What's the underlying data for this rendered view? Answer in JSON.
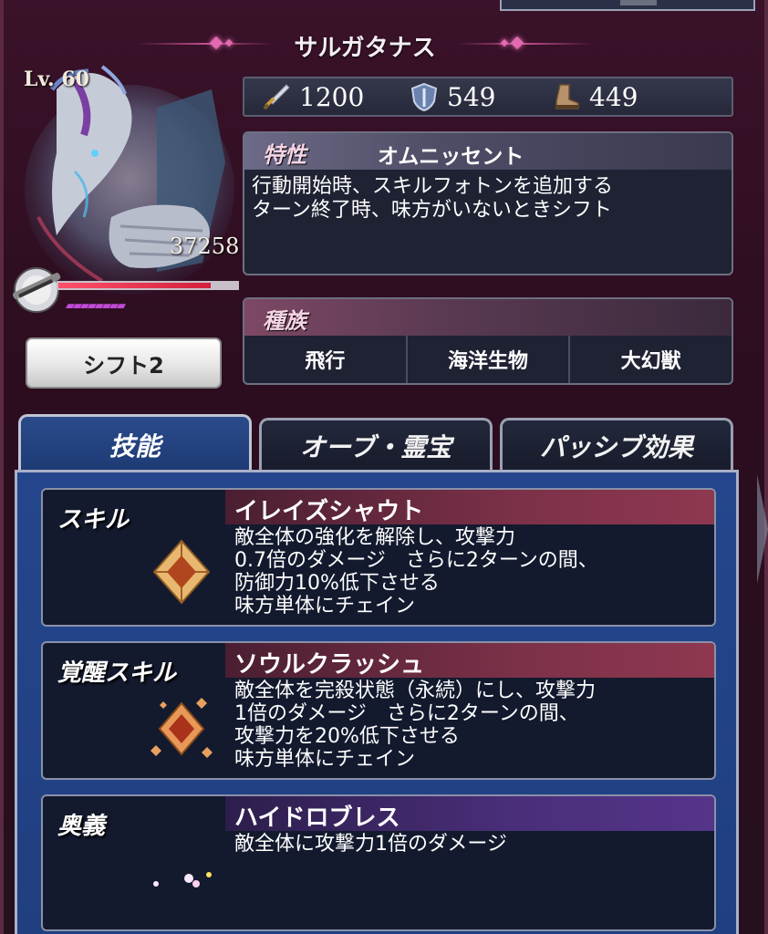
{
  "character": {
    "name": "サルガタナス",
    "level": "Lv. 60",
    "hp": "37258",
    "shift_gauge": 0.85
  },
  "shift_button": {
    "label": "シフト2"
  },
  "stats": {
    "attack": "1200",
    "defense": "549",
    "speed": "449"
  },
  "trait": {
    "label": "特性",
    "name": "オムニッセント",
    "description_lines": [
      "行動開始時、スキルフォトンを追加する",
      "ターン終了時、味方がいないときシフト"
    ]
  },
  "tribe": {
    "label": "種族",
    "items": [
      "飛行",
      "海洋生物",
      "大幻獣"
    ]
  },
  "tabs": [
    {
      "label": "技能",
      "active": true
    },
    {
      "label": "オーブ・霊宝",
      "active": false
    },
    {
      "label": "パッシブ効果",
      "active": false
    }
  ],
  "skills": [
    {
      "type": "スキル",
      "name": "イレイズシャウト",
      "description": "敵全体の強化を解除し、攻撃力\n0.7倍のダメージ　さらに2ターンの間、\n防御力10%低下させる\n味方単体にチェイン",
      "icon": "gold-crystal-icon"
    },
    {
      "type": "覚醒スキル",
      "name": "ソウルクラッシュ",
      "description": "敵全体を完殺状態（永続）にし、攻撃力\n1倍のダメージ　さらに2ターンの間、\n攻撃力を20%低下させる\n味方単体にチェイン",
      "icon": "awakened-crystal-icon"
    },
    {
      "type": "奥義",
      "name": "ハイドロブレス",
      "description": "敵全体に攻撃力1倍のダメージ",
      "icon": "crescent-moon-icon"
    }
  ],
  "colors": {
    "background": "#2c0d1f",
    "accent_pink": "#e36ab0",
    "tab_active": "#2a4a8a",
    "skill_bar_red": "#7c3148",
    "skill_bar_purple": "#4a2e7a"
  }
}
